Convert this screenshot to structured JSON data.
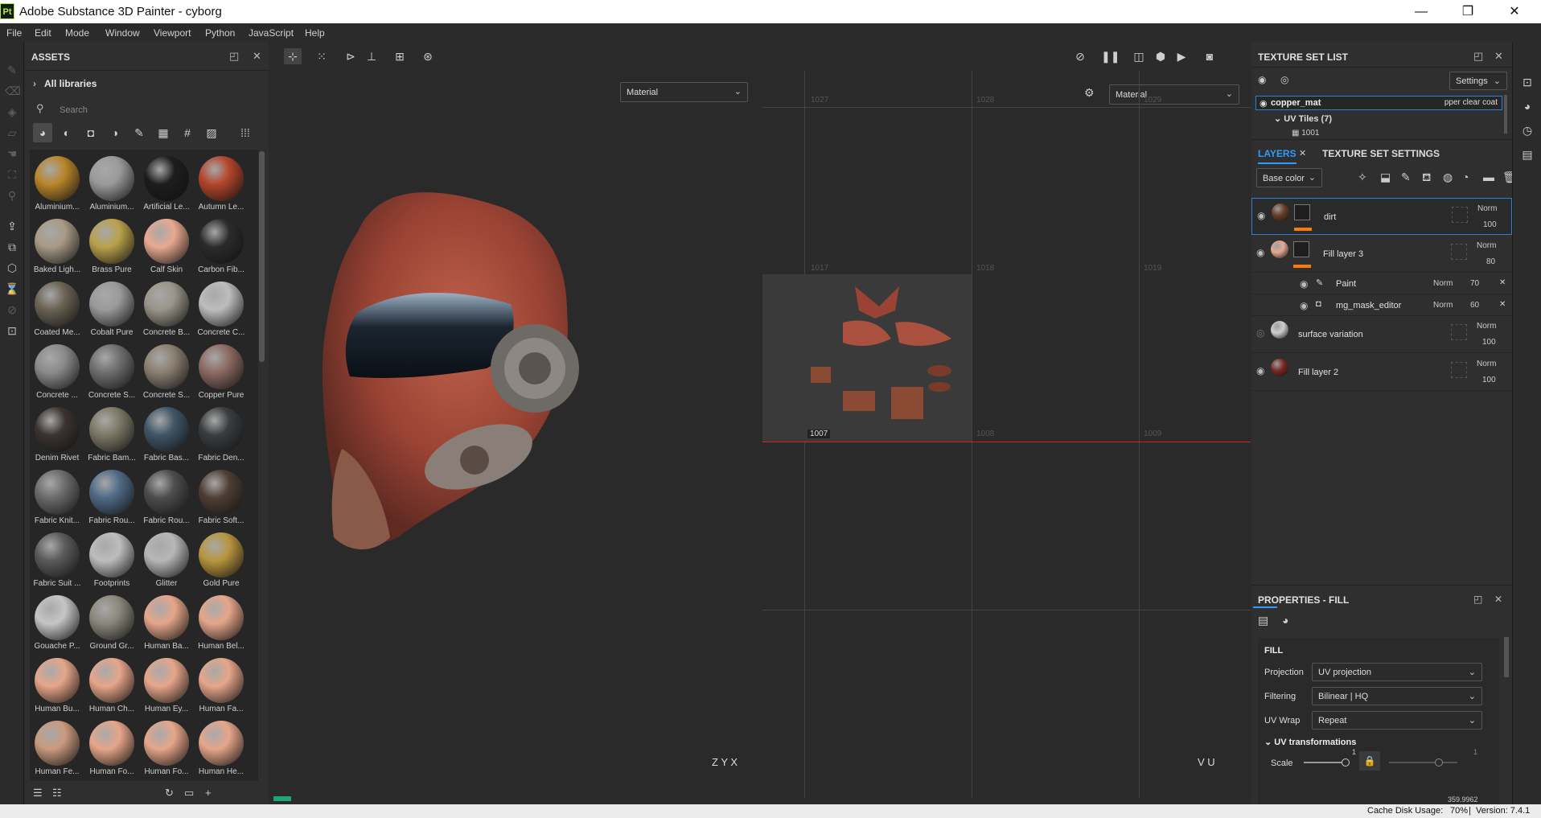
{
  "window": {
    "app_icon": "Pt",
    "title": "Adobe Substance 3D Painter - cyborg",
    "minimize": "—",
    "maximize": "❐",
    "close": "✕"
  },
  "menu": [
    "File",
    "Edit",
    "Mode",
    "Window",
    "Viewport",
    "Python",
    "JavaScript",
    "Help"
  ],
  "assets": {
    "title": "ASSETS",
    "libraries": "All libraries",
    "search_placeholder": "Search",
    "items": [
      {
        "name": "Aluminium...",
        "color": "#b8862a"
      },
      {
        "name": "Aluminium...",
        "color": "#9a9a9a"
      },
      {
        "name": "Artificial Le...",
        "color": "#1d1d1d"
      },
      {
        "name": "Autumn Le...",
        "color": "#b4452a"
      },
      {
        "name": "Baked Ligh...",
        "color": "#a89a85"
      },
      {
        "name": "Brass Pure",
        "color": "#b9a14a"
      },
      {
        "name": "Calf Skin",
        "color": "#e8a890"
      },
      {
        "name": "Carbon Fib...",
        "color": "#2b2b2b"
      },
      {
        "name": "Coated Me...",
        "color": "#6a6252"
      },
      {
        "name": "Cobalt Pure",
        "color": "#9a9a9a"
      },
      {
        "name": "Concrete B...",
        "color": "#9a948a"
      },
      {
        "name": "Concrete C...",
        "color": "#bdbdbd"
      },
      {
        "name": "Concrete ...",
        "color": "#8a8a8a"
      },
      {
        "name": "Concrete S...",
        "color": "#6f6f6f"
      },
      {
        "name": "Concrete S...",
        "color": "#8a7f70"
      },
      {
        "name": "Copper Pure",
        "color": "#8d6a62"
      },
      {
        "name": "Denim Rivet",
        "color": "#3a3330"
      },
      {
        "name": "Fabric Bam...",
        "color": "#7d7866"
      },
      {
        "name": "Fabric Bas...",
        "color": "#3f5566"
      },
      {
        "name": "Fabric Den...",
        "color": "#3a3d40"
      },
      {
        "name": "Fabric Knit...",
        "color": "#6b6b6b"
      },
      {
        "name": "Fabric Rou...",
        "color": "#4f6a85"
      },
      {
        "name": "Fabric Rou...",
        "color": "#4d4d4d"
      },
      {
        "name": "Fabric Soft...",
        "color": "#4e3e33"
      },
      {
        "name": "Fabric Suit ...",
        "color": "#5a5a5a"
      },
      {
        "name": "Footprints",
        "color": "#bdbdbd"
      },
      {
        "name": "Glitter",
        "color": "#b7b7b7"
      },
      {
        "name": "Gold Pure",
        "color": "#b8963e"
      },
      {
        "name": "Gouache P...",
        "color": "#c6c6c6"
      },
      {
        "name": "Ground Gr...",
        "color": "#8a877c"
      },
      {
        "name": "Human Ba...",
        "color": "#e6a68a"
      },
      {
        "name": "Human Bel...",
        "color": "#e6a68a"
      },
      {
        "name": "Human Bu...",
        "color": "#e6a68a"
      },
      {
        "name": "Human Ch...",
        "color": "#e6a68a"
      },
      {
        "name": "Human Ey...",
        "color": "#e6a68a"
      },
      {
        "name": "Human Fa...",
        "color": "#e6a68a"
      },
      {
        "name": "Human Fe...",
        "color": "#c99a7e"
      },
      {
        "name": "Human Fo...",
        "color": "#e6a68a"
      },
      {
        "name": "Human Fo...",
        "color": "#e6a68a"
      },
      {
        "name": "Human He...",
        "color": "#e6a68a"
      }
    ]
  },
  "viewport": {
    "view3d_mode": "Material",
    "view2d_mode": "Material",
    "uv_tiles_top": [
      "1027",
      "1028",
      "1029"
    ],
    "uv_tiles_mid": [
      "1017",
      "1018",
      "1019"
    ],
    "uv_tiles_bottom": [
      "1007",
      "1008",
      "1009"
    ],
    "axis_3d": "Z  Y  X",
    "axis_2d": "V  U"
  },
  "texture_set_list": {
    "title": "TEXTURE SET LIST",
    "settings_label": "Settings",
    "set_name": "copper_mat",
    "set_shader": "pper clear coat",
    "uv_tiles": "UV Tiles (7)",
    "first_tile": "1001"
  },
  "layers": {
    "tab_layers": "LAYERS",
    "tab_settings": "TEXTURE SET SETTINGS",
    "channel": "Base color",
    "rows": [
      {
        "name": "dirt",
        "blend": "Norm",
        "opacity": "100",
        "color": "#6a3e28",
        "selected": true
      },
      {
        "name": "Fill layer 3",
        "blend": "Norm",
        "opacity": "80",
        "color": "#e8a890",
        "selected": false
      },
      {
        "name": "surface variation",
        "blend": "Norm",
        "opacity": "100",
        "color": "#cfcfcf",
        "selected": false
      },
      {
        "name": "Fill layer 2",
        "blend": "Norm",
        "opacity": "100",
        "color": "#7a2a22",
        "selected": false
      }
    ],
    "effects": [
      {
        "name": "Paint",
        "blend": "Norm",
        "opacity": "70"
      },
      {
        "name": "mg_mask_editor",
        "blend": "Norm",
        "opacity": "60"
      }
    ]
  },
  "properties": {
    "title": "PROPERTIES - FILL",
    "section": "FILL",
    "projection_label": "Projection",
    "projection_value": "UV projection",
    "filtering_label": "Filtering",
    "filtering_value": "Bilinear | HQ",
    "uvwrap_label": "UV Wrap",
    "uvwrap_value": "Repeat",
    "uv_transforms": "UV transformations",
    "scale_label": "Scale",
    "scale_value_1": "1",
    "scale_value_2": "1",
    "rotation_partial": "359.9962"
  },
  "status": {
    "cache": "Cache Disk Usage:",
    "cache_value": "70%",
    "version": "Version: 7.4.1"
  },
  "colors": {
    "accent": "#2f7fd6",
    "selection": "#2f7fd6",
    "opacity_bar": "#ff7a00",
    "uv_line": "#d22424"
  }
}
